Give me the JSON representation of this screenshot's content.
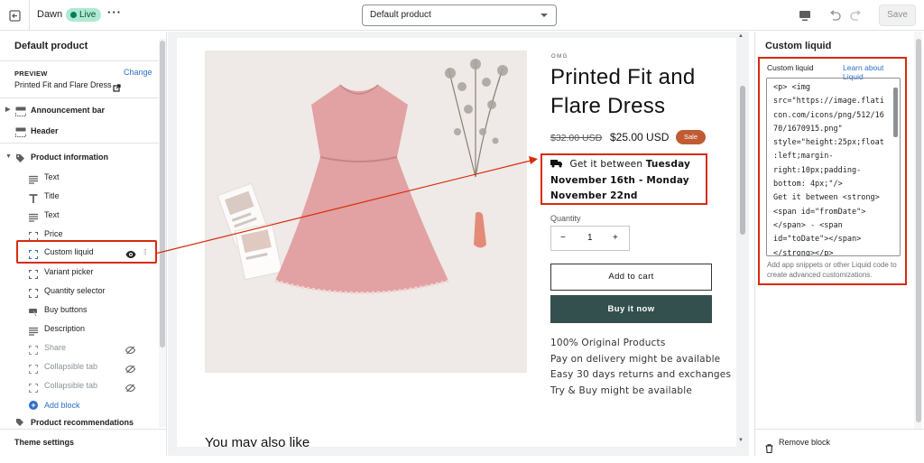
{
  "topbar": {
    "theme_name": "Dawn",
    "status_badge": "Live",
    "template_select": "Default product",
    "save_label": "Save"
  },
  "left_panel": {
    "title": "Default product",
    "preview_label": "PREVIEW",
    "change_label": "Change",
    "preview_product": "Printed Fit and Flare Dress",
    "sections": [
      {
        "label": "Announcement bar",
        "icon": "section-icon"
      },
      {
        "label": "Header",
        "icon": "section-icon"
      },
      {
        "label": "Product information",
        "icon": "tag-icon"
      }
    ],
    "blocks": [
      {
        "label": "Text",
        "icon": "text-icon"
      },
      {
        "label": "Title",
        "icon": "title-icon"
      },
      {
        "label": "Text",
        "icon": "text-icon"
      },
      {
        "label": "Price",
        "icon": "frame-icon"
      },
      {
        "label": "Custom liquid",
        "icon": "frame-icon",
        "selected": true
      },
      {
        "label": "Variant picker",
        "icon": "frame-icon"
      },
      {
        "label": "Quantity selector",
        "icon": "frame-icon"
      },
      {
        "label": "Buy buttons",
        "icon": "buy-icon"
      },
      {
        "label": "Description",
        "icon": "text-icon"
      },
      {
        "label": "Share",
        "icon": "frame-icon",
        "hidden": true
      },
      {
        "label": "Collapsible tab",
        "icon": "frame-icon",
        "hidden": true
      },
      {
        "label": "Collapsible tab",
        "icon": "frame-icon",
        "hidden": true
      }
    ],
    "add_block": "Add block",
    "next_section": "Product recommendations",
    "footer": "Theme settings"
  },
  "preview": {
    "vendor": "OMG",
    "title": "Printed Fit and Flare Dress",
    "price_old": "$32.00 USD",
    "price_new": "$25.00 USD",
    "sale_badge": "Sale",
    "delivery_prefix": "Get it between ",
    "delivery_from": "Tuesday November 16th",
    "delivery_sep": " - ",
    "delivery_to": "Monday November 22nd",
    "quantity_label": "Quantity",
    "quantity_minus": "−",
    "quantity_value": "1",
    "quantity_plus": "+",
    "add_to_cart": "Add to cart",
    "buy_now": "Buy it now",
    "features": [
      "100% Original Products",
      "Pay on delivery might be available",
      "Easy 30 days returns and exchanges",
      "Try & Buy might be available"
    ],
    "also_like": "You may also like"
  },
  "right_panel": {
    "title": "Custom liquid",
    "field_label": "Custom liquid",
    "learn_link": "Learn about Liquid",
    "code": "<p> <img\nsrc=\"https://image.flati\ncon.com/icons/png/512/16\n70/1670915.png\"\nstyle=\"height:25px;float\n:left;margin-\nright:10px;padding-\nbottom: 4px;\"/>\nGet it between <strong>\n<span id=\"fromDate\">\n</span> - <span\nid=\"toDate\"></span>\n</strong></p>",
    "help": "Add app snippets or other Liquid code to create advanced customizations.",
    "remove_block": "Remove block"
  },
  "colors": {
    "highlight": "#d72c0d",
    "link": "#2c6ecb",
    "buy_button": "#334f4e",
    "sale_badge": "#c15b33"
  }
}
